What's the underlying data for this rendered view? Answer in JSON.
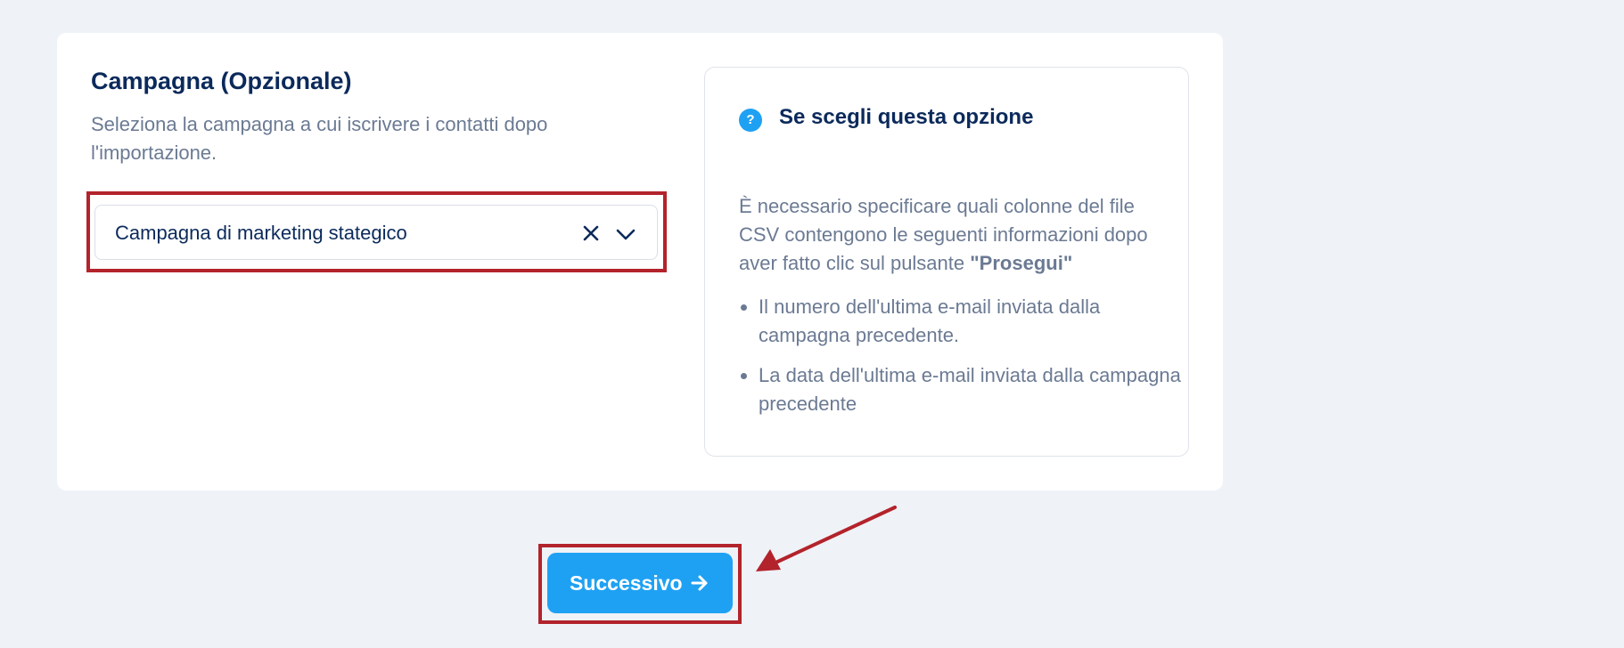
{
  "campaign": {
    "title": "Campagna (Opzionale)",
    "description": "Seleziona la campagna a cui iscrivere i contatti dopo l'importazione.",
    "selected_value": "Campagna di marketing stategico",
    "clear_icon": "close-icon",
    "dropdown_icon": "chevron-down-icon"
  },
  "info": {
    "icon": "question-icon",
    "icon_glyph": "?",
    "title": "Se scegli questa opzione",
    "text": "È necessario specificare quali colonne del file CSV contengono le seguenti informazioni dopo aver fatto clic sul pulsante ",
    "text_strong": "\"Prosegui\"",
    "bullets": [
      "Il numero dell'ultima e-mail inviata dalla campagna precedente.",
      "La data dell'ultima e-mail inviata dalla campagna precedente"
    ]
  },
  "next_button": {
    "label": "Successivo",
    "icon": "arrow-right-icon"
  },
  "colors": {
    "accent": "#1fa1f3",
    "heading": "#0b2a5b",
    "body_text": "#6b7a93",
    "highlight_border": "#b3232b",
    "background": "#eff2f7"
  }
}
